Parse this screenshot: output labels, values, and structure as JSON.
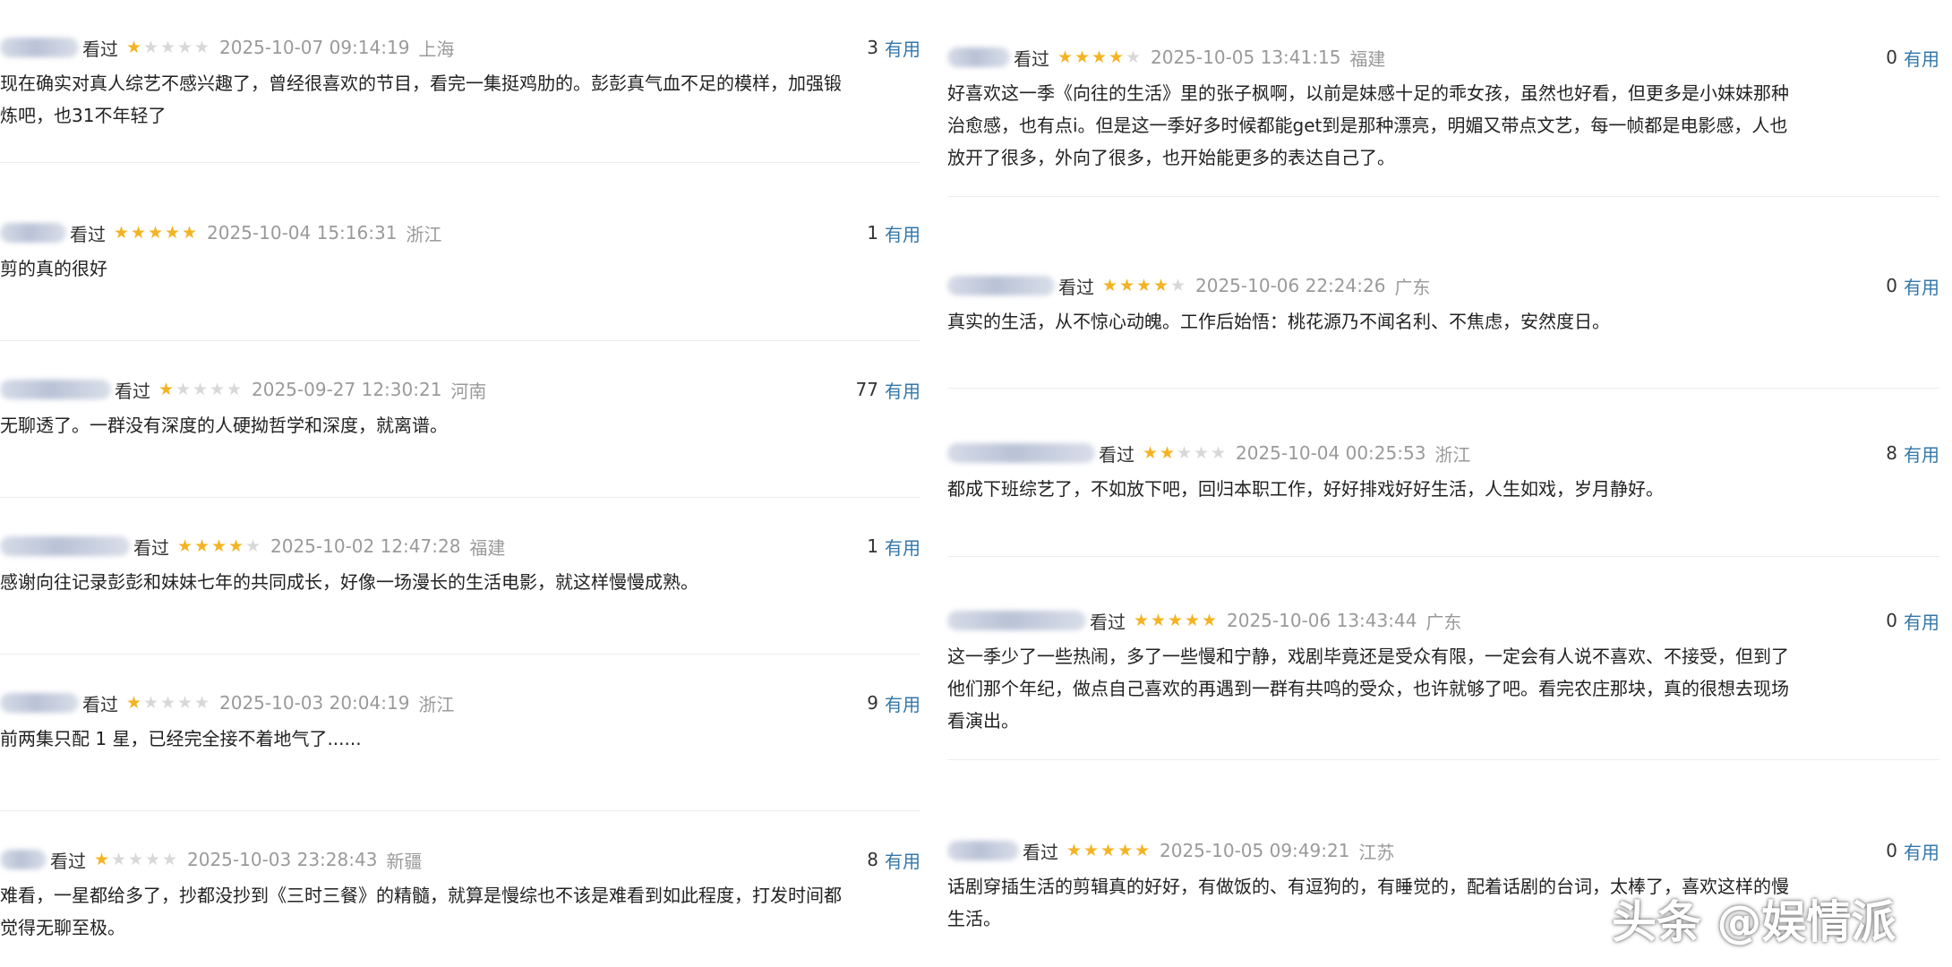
{
  "colors": {
    "star_on": "#f4b323",
    "star_off": "#d8d8d8",
    "useful_link": "#3377aa",
    "meta_grey": "#9a9a9a"
  },
  "left_reviews": [
    {
      "status": "看过",
      "rating": 1,
      "date": "2025-10-07 09:14:19",
      "region": "上海",
      "useful_count": "3",
      "useful_label": "有用",
      "lines": [
        "现在确实对真人综艺不感兴趣了，曾经很喜欢的节目，看完一集挺鸡肋的。彭彭真气血不足的模样，加强锻",
        "炼吧，也31不年轻了"
      ]
    },
    {
      "status": "看过",
      "rating": 5,
      "date": "2025-10-04 15:16:31",
      "region": "浙江",
      "useful_count": "1",
      "useful_label": "有用",
      "lines": [
        "剪的真的很好"
      ]
    },
    {
      "status": "看过",
      "rating": 1,
      "date": "2025-09-27 12:30:21",
      "region": "河南",
      "useful_count": "77",
      "useful_label": "有用",
      "lines": [
        "无聊透了。一群没有深度的人硬拗哲学和深度，就离谱。"
      ]
    },
    {
      "status": "看过",
      "rating": 4,
      "date": "2025-10-02 12:47:28",
      "region": "福建",
      "useful_count": "1",
      "useful_label": "有用",
      "lines": [
        "感谢向往记录彭彭和妹妹七年的共同成长，好像一场漫长的生活电影，就这样慢慢成熟。"
      ]
    },
    {
      "status": "看过",
      "rating": 1,
      "date": "2025-10-03 20:04:19",
      "region": "浙江",
      "useful_count": "9",
      "useful_label": "有用",
      "lines": [
        "前两集只配 1 星，已经完全接不着地气了......"
      ]
    },
    {
      "status": "看过",
      "rating": 1,
      "date": "2025-10-03 23:28:43",
      "region": "新疆",
      "useful_count": "8",
      "useful_label": "有用",
      "lines": [
        "难看，一星都给多了，抄都没抄到《三时三餐》的精髓，就算是慢综也不该是难看到如此程度，打发时间都",
        "觉得无聊至极。"
      ]
    }
  ],
  "right_reviews": [
    {
      "status": "看过",
      "rating": 4,
      "date": "2025-10-05 13:41:15",
      "region": "福建",
      "useful_count": "0",
      "useful_label": "有用",
      "lines": [
        "好喜欢这一季《向往的生活》里的张子枫啊，以前是妹感十足的乖女孩，虽然也好看，但更多是小妹妹那种",
        "治愈感，也有点i。但是这一季好多时候都能get到是那种漂亮，明媚又带点文艺，每一帧都是电影感，人也",
        "放开了很多，外向了很多，也开始能更多的表达自己了。"
      ]
    },
    {
      "status": "看过",
      "rating": 4,
      "date": "2025-10-06 22:24:26",
      "region": "广东",
      "useful_count": "0",
      "useful_label": "有用",
      "lines": [
        "真实的生活，从不惊心动魄。工作后始悟：桃花源乃不闻名利、不焦虑，安然度日。"
      ]
    },
    {
      "status": "看过",
      "rating": 2,
      "date": "2025-10-04 00:25:53",
      "region": "浙江",
      "useful_count": "8",
      "useful_label": "有用",
      "lines": [
        "都成下班综艺了，不如放下吧，回归本职工作，好好排戏好好生活，人生如戏，岁月静好。"
      ]
    },
    {
      "status": "看过",
      "rating": 5,
      "date": "2025-10-06 13:43:44",
      "region": "广东",
      "useful_count": "0",
      "useful_label": "有用",
      "lines": [
        "这一季少了一些热闹，多了一些慢和宁静，戏剧毕竟还是受众有限，一定会有人说不喜欢、不接受，但到了",
        "他们那个年纪，做点自己喜欢的再遇到一群有共鸣的受众，也许就够了吧。看完农庄那块，真的很想去现场",
        "看演出。"
      ]
    },
    {
      "status": "看过",
      "rating": 5,
      "date": "2025-10-05 09:49:21",
      "region": "江苏",
      "useful_count": "0",
      "useful_label": "有用",
      "lines": [
        "话剧穿插生活的剪辑真的好好，有做饭的、有逗狗的，有睡觉的，配着话剧的台词，太棒了，喜欢这样的慢",
        "生活。"
      ]
    }
  ],
  "watermark": "头条 @娱情派"
}
